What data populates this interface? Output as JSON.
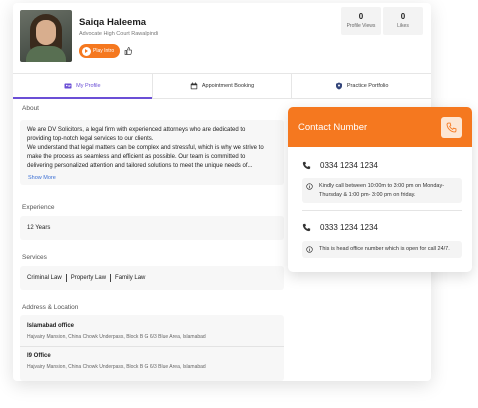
{
  "profile": {
    "name": "Saiqa Haleema",
    "subtitle": "Advocate High Court Rawalpindi",
    "play_label": "Play Intro"
  },
  "stats": [
    {
      "value": "0",
      "label": "Profile Views"
    },
    {
      "value": "0",
      "label": "Likes"
    }
  ],
  "tabs": [
    {
      "label": "My Profile",
      "icon": "profile-card-icon",
      "active": true
    },
    {
      "label": "Appointment Booking",
      "icon": "calendar-icon",
      "active": false
    },
    {
      "label": "Practice Portfolio",
      "icon": "portfolio-icon",
      "active": false
    }
  ],
  "about": {
    "heading": "About",
    "lines": [
      "We are DV Solicitors, a legal firm with experienced attorneys who are dedicated to",
      "providing top-notch legal services to our clients.",
      "We understand that legal matters can be complex and stressful, which is why we strive to",
      "make the process as seamless and efficient as possible. Our team is committed to",
      "delivering personalized attention and tailored solutions to meet the unique needs of..."
    ],
    "show_more": "Show More"
  },
  "experience": {
    "heading": "Experience",
    "value": "12 Years"
  },
  "services": {
    "heading": "Services",
    "items": [
      "Criminal Law",
      "Property Law",
      "Family Law"
    ]
  },
  "address": {
    "heading": "Address & Location",
    "items": [
      {
        "title": "Islamabad office",
        "line": "Hajvairy Mansion, China Chowk Underpass, Block B G 6/3 Blue Area, Islamabad"
      },
      {
        "title": "I9 Office",
        "line": "Hajvairy Mansion, China Chowk Underpass, Block B G 6/3 Blue Area, Islamabad"
      }
    ]
  },
  "contact": {
    "title": "Contact Number",
    "numbers": [
      {
        "number": "0334 1234 1234",
        "note": "Kindly call between 10:00m to 3:00 pm on Monday-Thursday & 1:00 pm- 3:00 pm on friday."
      },
      {
        "number": "0333 1234 1234",
        "note": "This is head office number which is open for call 24/7."
      }
    ]
  },
  "colors": {
    "accent": "#f5781f",
    "tab_active": "#6b4fd6",
    "link": "#3b6fd4"
  }
}
